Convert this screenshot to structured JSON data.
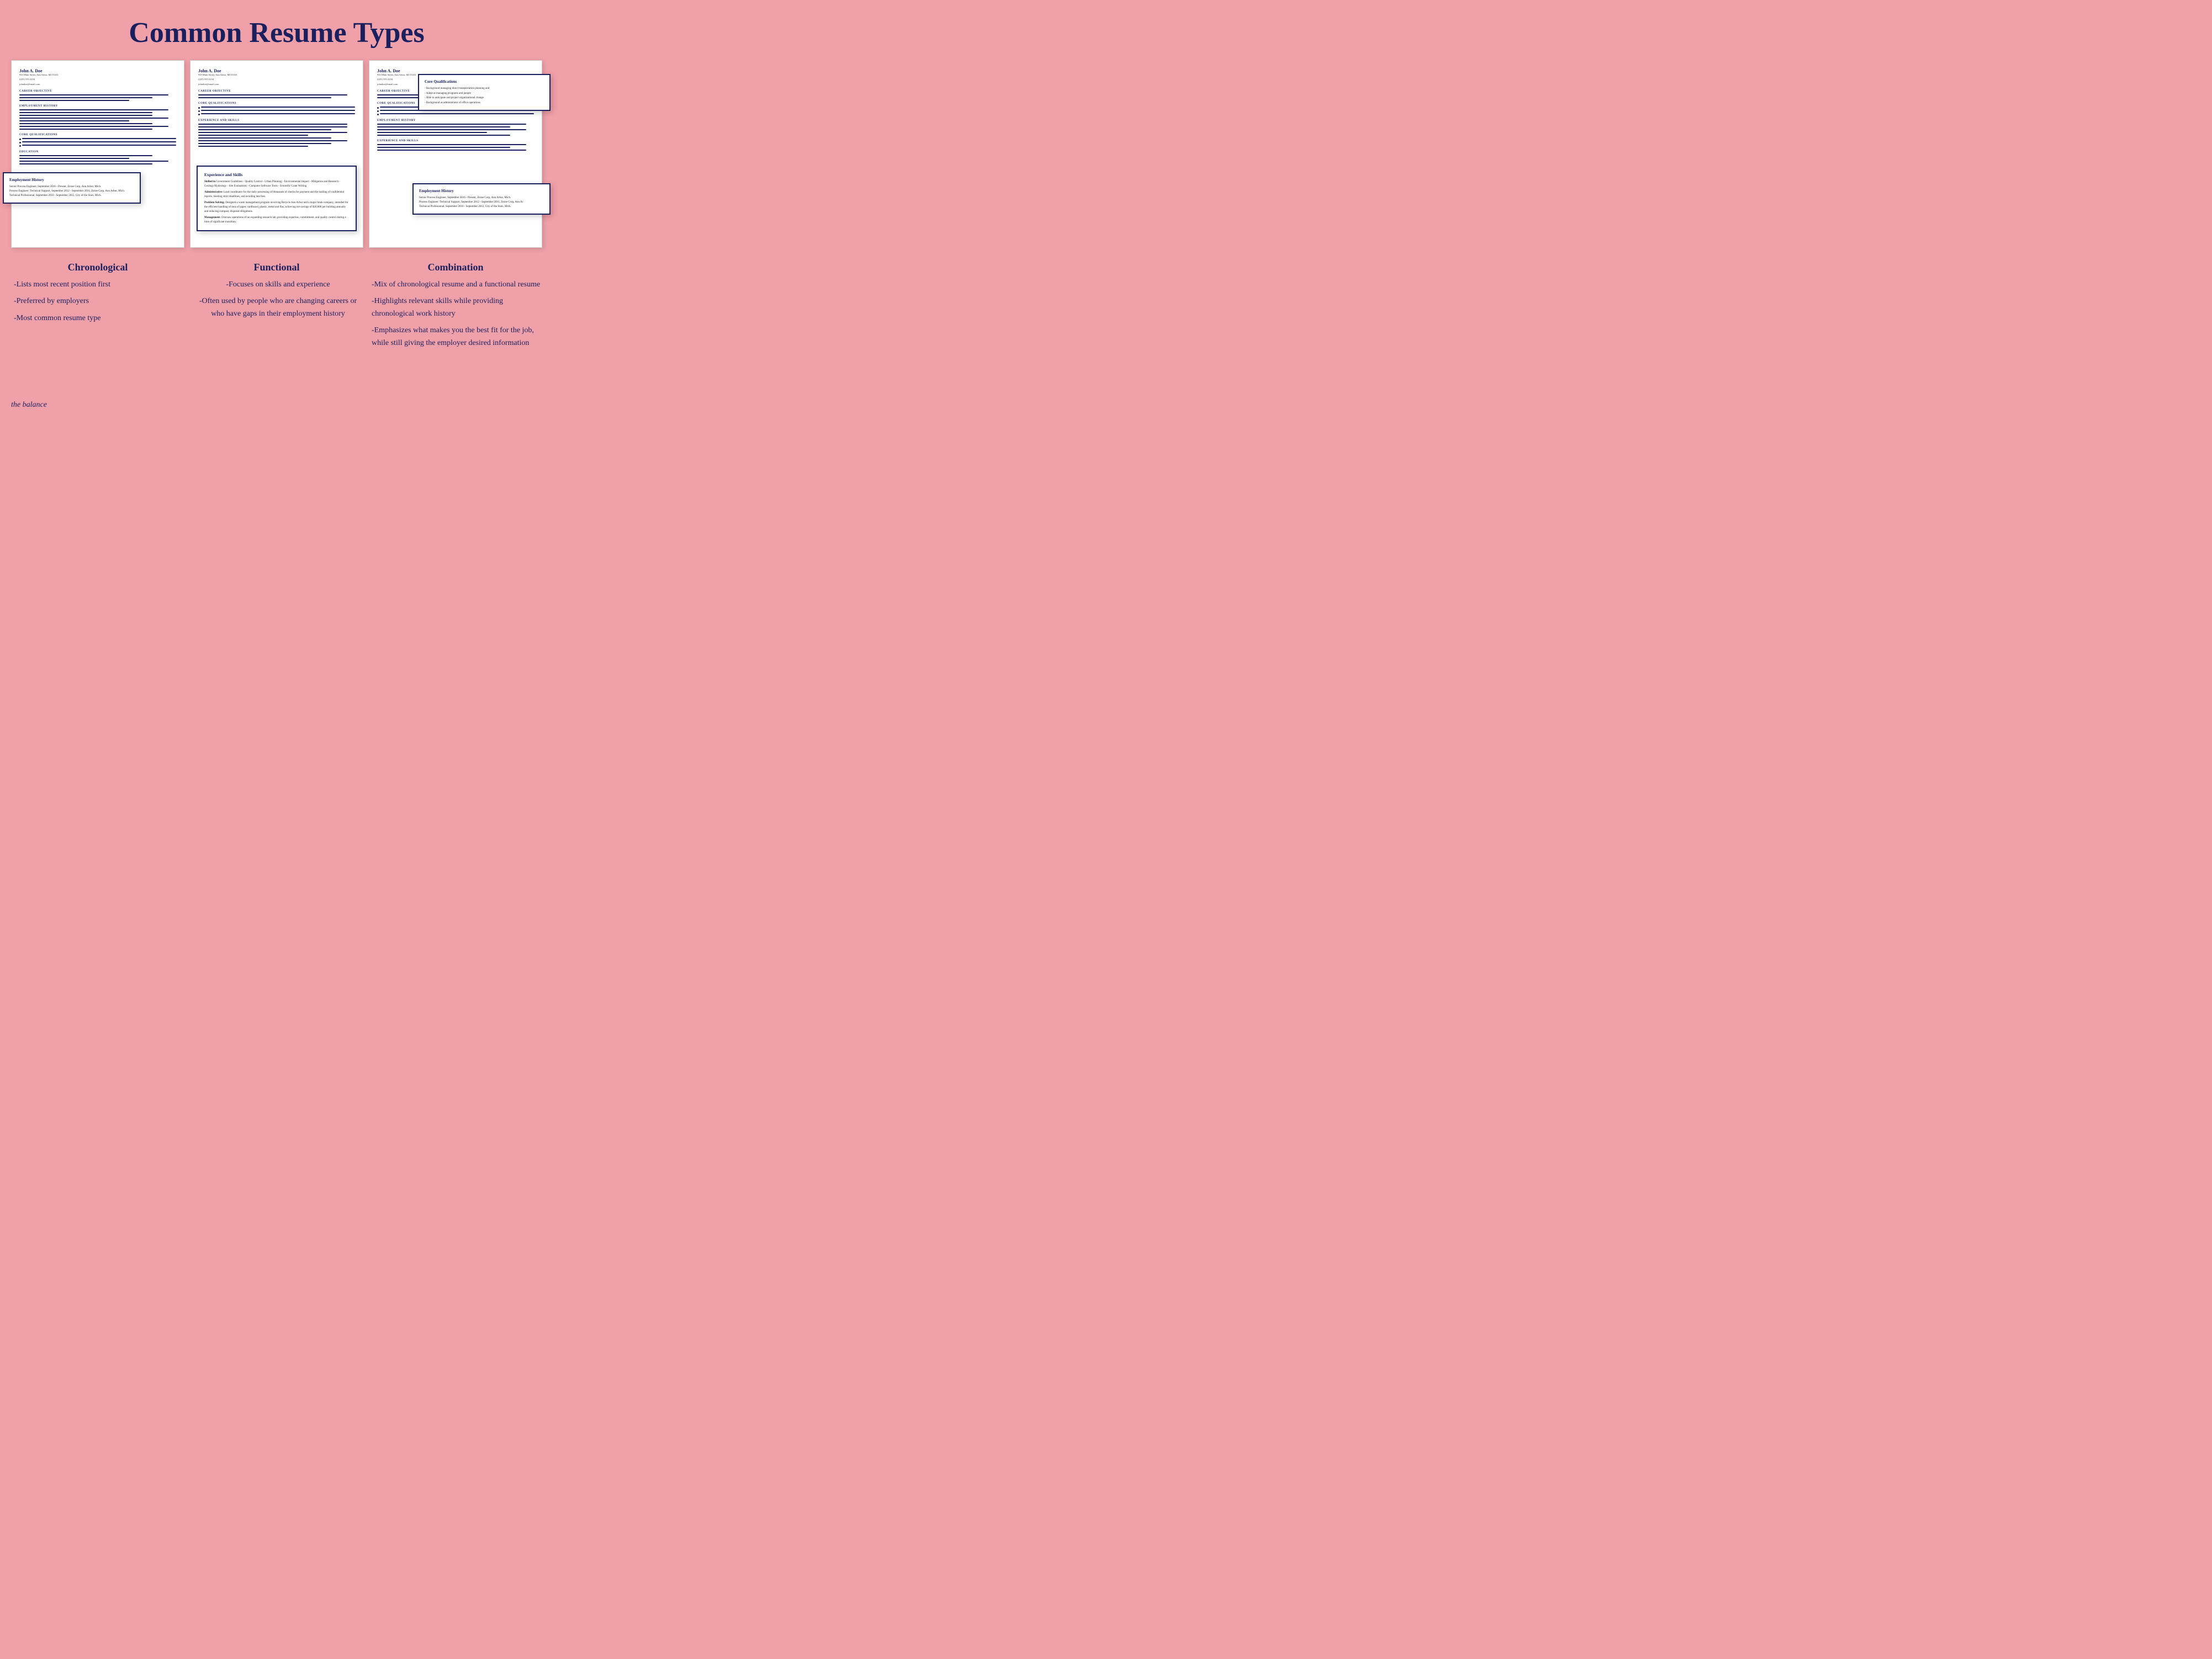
{
  "page": {
    "title": "Common Resume Types",
    "background_color": "#f0a0a8",
    "brand": "the balance"
  },
  "resume_types": [
    {
      "id": "chronological",
      "label": "Chronological",
      "description_items": [
        "-Lists most recent position first",
        "-Preferred by employers",
        "-Most common resume type"
      ]
    },
    {
      "id": "functional",
      "label": "Functional",
      "description_items": [
        "-Focuses on skills and experience",
        "-Often used by people who are changing careers or who have gaps in their employment history"
      ]
    },
    {
      "id": "combination",
      "label": "Combination",
      "description_items": [
        "-Mix of chronological resume and a functional resume",
        "-Highlights relevant skills while providing chronological work history",
        "-Emphasizes what makes you the best fit for the job, while still giving the employer desired information"
      ]
    }
  ],
  "resume_person": {
    "name": "John A. Doe",
    "address": "935 Main Street, Ann Arbor, MI 55333",
    "phone": "(225) 555-2234",
    "email": "johndoe@email.com"
  },
  "callouts": {
    "chronological": {
      "title": "Employment History",
      "lines": [
        "Senior Process Engineer, September 2016 - Present, Zezee Corp, Ann Arbor, Mich.",
        "Process Engineer: Technical Support, September 2012 - September 2016, Zezee Corp, Ann Arbor, Mich.",
        "Technical Professional, September 2010 - September 2012, City of the Stars, Mich."
      ]
    },
    "functional": {
      "title": "Experience and Skills",
      "lines": [
        "Skilled in Government Guidelines - Quality Control - Urban Planning - Environmental Impact - Mitigation and Research - Geology/Hydrology - Site Evaluations - Computer Software Tools - Scientific Grant Writing",
        "Administrative: Lead coordinator for the daily processing of thousands of checks for payment and the mailing of confidential reports, meeting strict deadlines, and avoiding late fees.",
        "Problem Solving: Designed a waste management program involving Recycle Ann Arbor and a major book company, intended for the efficient handling of tons of paper, cardboard, plastic, metal and flas, achieving net savings of $20,000 per building annually and reducing company disposal obligations.",
        "Management: Oversaw operations of an expanding research lab, providing expertise, commitment, and quality control during a time of significant transition."
      ]
    },
    "combination_core": {
      "title": "Core Qualifications",
      "lines": [
        "- Background managing direct transportation planning and",
        "- Adept at managing programs and people",
        "- Able to anticipate and project organizational change",
        "- Background as administrator of office operations"
      ]
    },
    "combination_emp": {
      "title": "Employment History",
      "lines": [
        "Senior Process Engineer, September 2016 - Present, Zezee Corp, Ann Arbor, Mich.",
        "Process Engineer: Technical Support, September 2012 - September 2016, Zezee Corp, Ann Ar",
        "Technical Professional, September 2010 - September 2012, City of the Stars, Mich."
      ]
    }
  },
  "sections": {
    "career_objective": "CAREER OBJECTIVE",
    "employment_history": "EMPLOYMENT HISTORY",
    "core_qualifications": "CORE QUALIFICATIONS",
    "education": "EDUCATION",
    "experience_and_skills": "EXPERIENCE AND SKILLS"
  }
}
